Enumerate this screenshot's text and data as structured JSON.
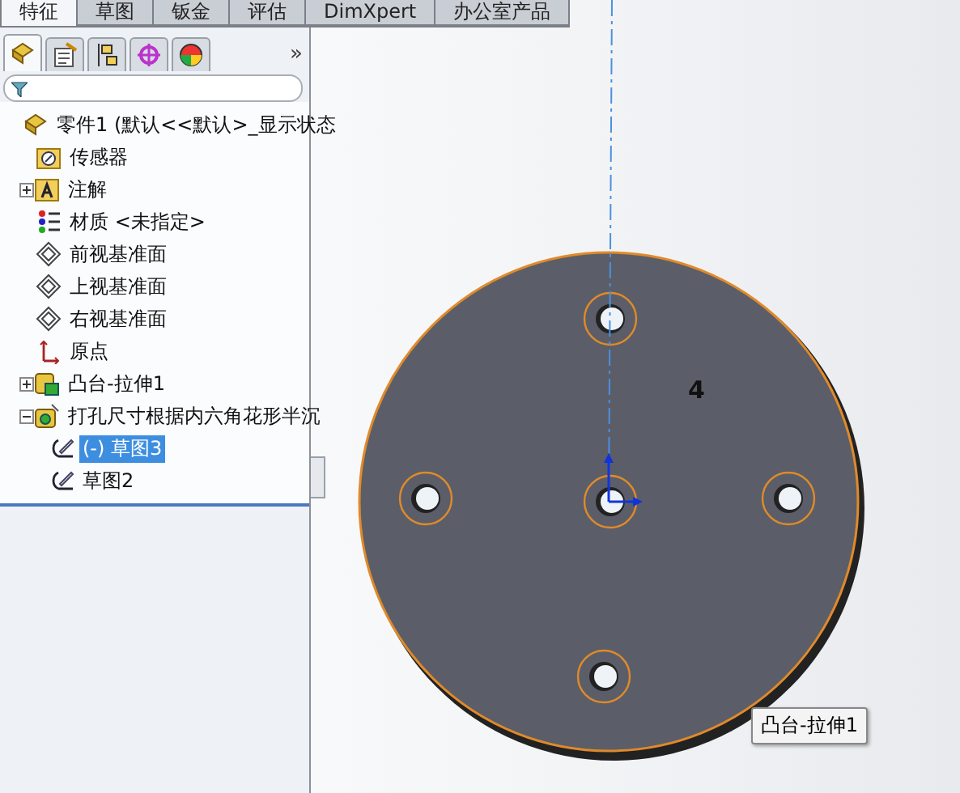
{
  "command_tabs": [
    {
      "label": "特征",
      "selected": true
    },
    {
      "label": "草图",
      "selected": false
    },
    {
      "label": "钣金",
      "selected": false
    },
    {
      "label": "评估",
      "selected": false
    },
    {
      "label": "DimXpert",
      "selected": false
    },
    {
      "label": "办公室产品",
      "selected": false
    }
  ],
  "panel_tabs": [
    {
      "kind": "feature",
      "selected": true
    },
    {
      "kind": "property",
      "selected": false
    },
    {
      "kind": "config",
      "selected": false
    },
    {
      "kind": "target",
      "selected": false
    },
    {
      "kind": "display",
      "selected": false
    }
  ],
  "panel_more": "»",
  "tree": {
    "label": "零件1  (默认<<默认>_显示状态",
    "kind": "part",
    "children": [
      {
        "label": "传感器",
        "kind": "sensor"
      },
      {
        "label": "注解",
        "kind": "annotation",
        "expanded": false
      },
      {
        "label": "材质 <未指定>",
        "kind": "material"
      },
      {
        "label": "前视基准面",
        "kind": "plane"
      },
      {
        "label": "上视基准面",
        "kind": "plane"
      },
      {
        "label": "右视基准面",
        "kind": "plane"
      },
      {
        "label": "原点",
        "kind": "origin"
      },
      {
        "label": "凸台-拉伸1",
        "kind": "extrude",
        "expanded": false
      },
      {
        "label": "打孔尺寸根据内六角花形半沉",
        "kind": "hole",
        "expanded": true,
        "children": [
          {
            "label": "(-) 草图3",
            "kind": "sketch",
            "selected": true
          },
          {
            "label": "草图2",
            "kind": "sketch",
            "selected": false
          }
        ]
      }
    ]
  },
  "viewport": {
    "note": "4",
    "tooltip": "凸台-拉伸1"
  }
}
